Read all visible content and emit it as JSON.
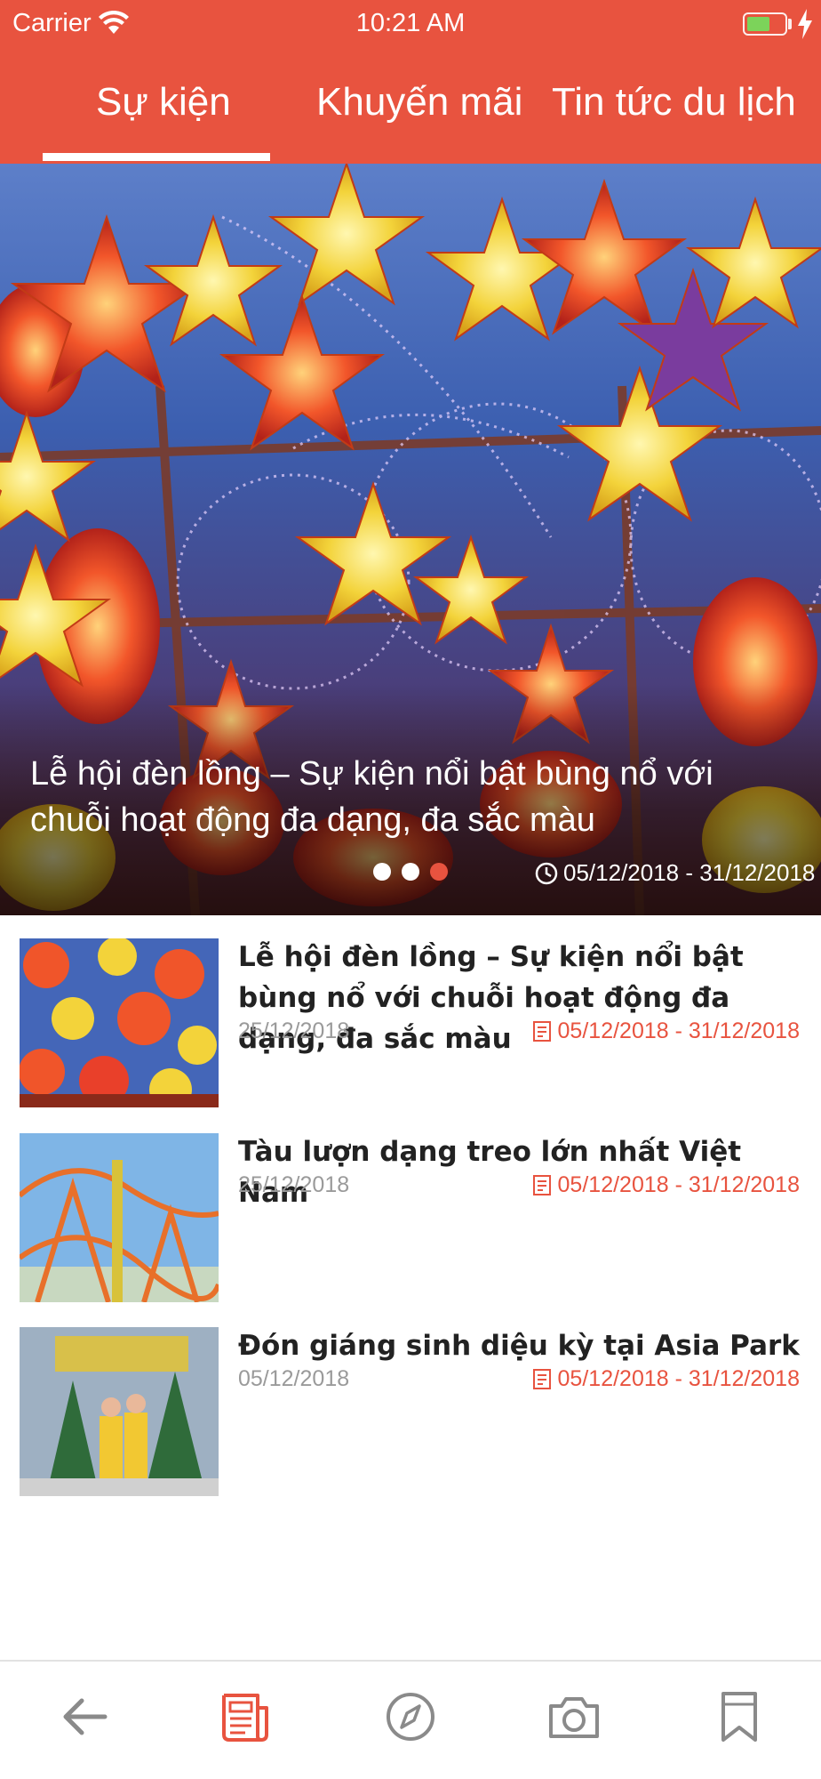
{
  "status_bar": {
    "carrier": "Carrier",
    "time": "10:21 AM"
  },
  "tabs": [
    {
      "label": "Sự kiện",
      "active": true
    },
    {
      "label": "Khuyến mãi",
      "active": false
    },
    {
      "label": "Tin tức du lịch",
      "active": false
    }
  ],
  "hero": {
    "title": "Lễ hội đèn lồng – Sự kiện nổi bật bùng nổ với chuỗi hoạt động đa dạng, đa sắc màu",
    "date_range": "05/12/2018 - 31/12/2018",
    "slide_count": 3,
    "active_slide": 3
  },
  "items": [
    {
      "title": "Lễ hội đèn lồng – Sự kiện nổi bật bùng nổ với chuỗi hoạt động đa dạng, đa sắc màu",
      "published": "25/12/2018",
      "date_range": "05/12/2018 - 31/12/2018"
    },
    {
      "title": "Tàu lượn dạng treo lớn nhất Việt Nam",
      "published": "25/12/2018",
      "date_range": "05/12/2018 - 31/12/2018"
    },
    {
      "title": "Đón giáng sinh diệu kỳ tại Asia Park",
      "published": "05/12/2018",
      "date_range": "05/12/2018 - 31/12/2018"
    }
  ],
  "bottom_nav": [
    {
      "icon": "back-arrow-icon",
      "active": false
    },
    {
      "icon": "news-icon",
      "active": true
    },
    {
      "icon": "compass-icon",
      "active": false
    },
    {
      "icon": "camera-icon",
      "active": false
    },
    {
      "icon": "bookmark-icon",
      "active": false
    }
  ],
  "colors": {
    "accent": "#E8533F",
    "muted_text": "#9a9a9a",
    "title_text": "#222222",
    "inactive_icon": "#8a8a8a"
  }
}
